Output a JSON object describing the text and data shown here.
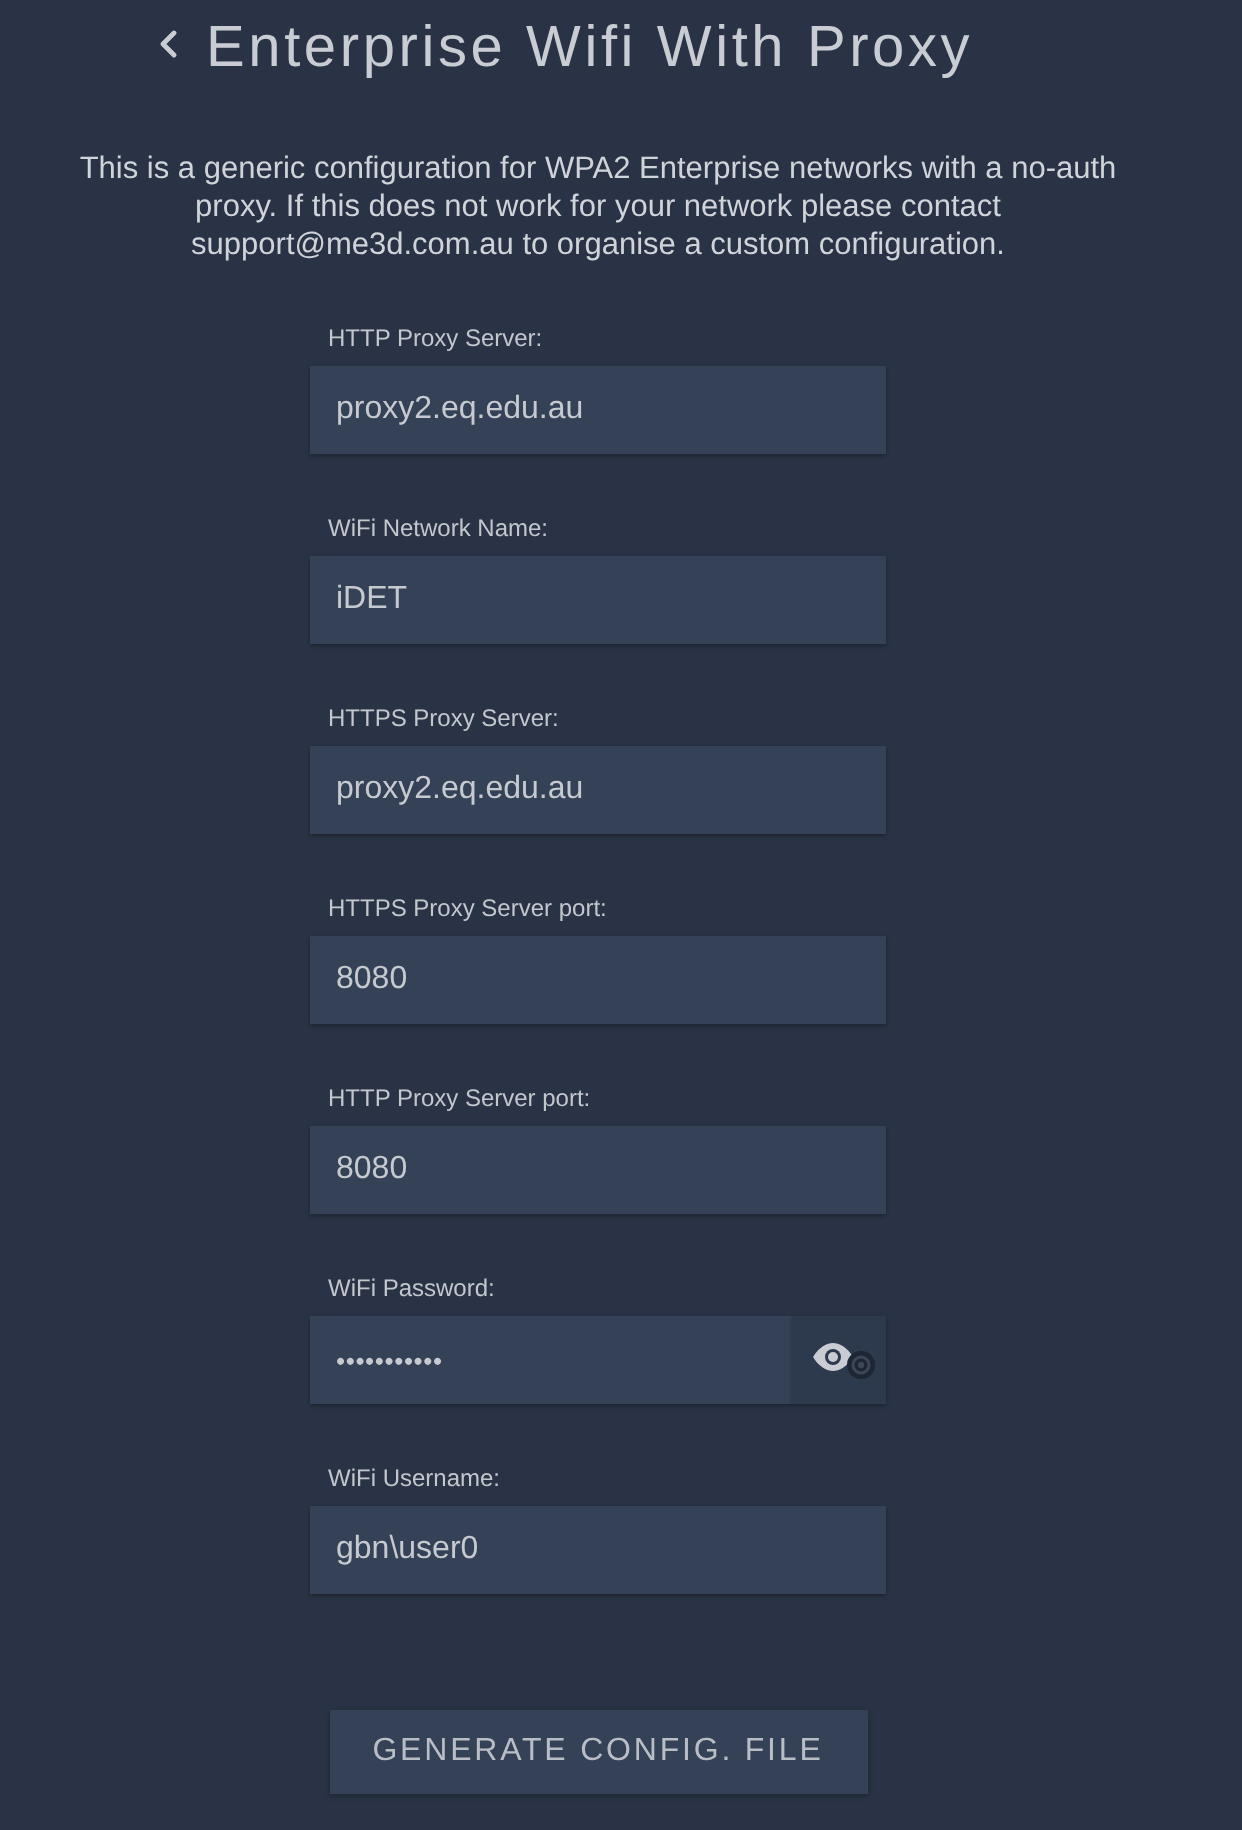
{
  "header": {
    "title": "Enterprise Wifi With Proxy"
  },
  "description": "This is a generic configuration for WPA2 Enterprise networks with a no-auth proxy. If this does not work for your network please contact support@me3d.com.au to organise a custom configuration.",
  "fields": [
    {
      "kind": "text",
      "label": "HTTP Proxy Server:",
      "value": "proxy2.eq.edu.au"
    },
    {
      "kind": "text",
      "label": "WiFi Network Name:",
      "value": "iDET"
    },
    {
      "kind": "text",
      "label": "HTTPS Proxy Server:",
      "value": "proxy2.eq.edu.au"
    },
    {
      "kind": "text",
      "label": "HTTPS Proxy Server port:",
      "value": "8080"
    },
    {
      "kind": "text",
      "label": "HTTP Proxy Server port:",
      "value": "8080"
    },
    {
      "kind": "password",
      "label": "WiFi Password:",
      "value": "•••••••••••"
    },
    {
      "kind": "text",
      "label": "WiFi Username:",
      "value": "gbn\\user0"
    }
  ],
  "button": "GENERATE CONFIG. FILE"
}
